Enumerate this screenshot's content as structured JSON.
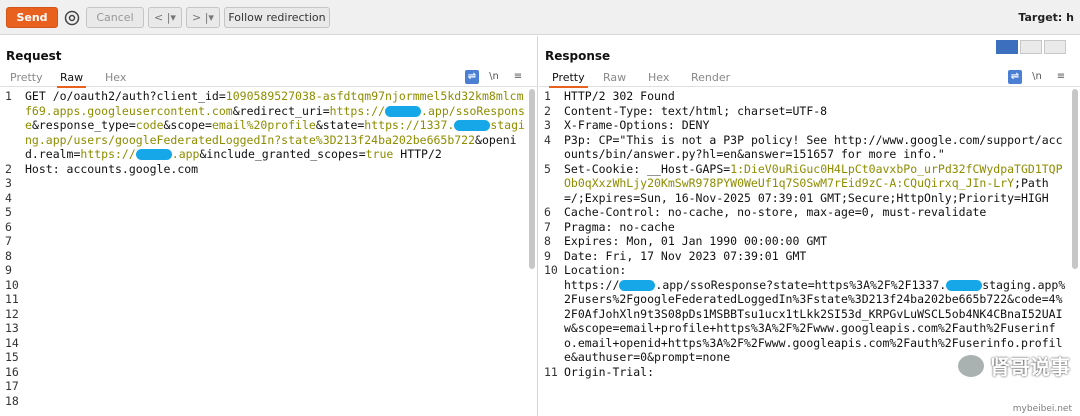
{
  "toolbar": {
    "send_label": "Send",
    "cancel_label": "Cancel",
    "back_label": "< |▾",
    "fwd_label": "> |▾",
    "follow_label": "Follow redirection",
    "target_label": "Target: h"
  },
  "request": {
    "title": "Request",
    "tabs": [
      "Pretty",
      "Raw",
      "Hex"
    ],
    "active_tab": "Raw",
    "wrap_icon": "\\n",
    "menu_icon": "≡",
    "lines": [
      {
        "n": "1",
        "segments": [
          {
            "t": "GET /o/oauth2/auth?client_id=",
            "c": "k"
          },
          {
            "t": "1090589527038-asfdtqm97njormmel5kd32km8mlcmf69.apps.googleusercontent.com",
            "c": "g"
          },
          {
            "t": "&redirect_uri=",
            "c": "k"
          },
          {
            "t": "https://",
            "c": "g"
          },
          {
            "t": "[mask]",
            "c": "mask"
          },
          {
            "t": ".app/ssoResponse",
            "c": "g"
          },
          {
            "t": "&response_type=",
            "c": "k"
          },
          {
            "t": "code",
            "c": "g"
          },
          {
            "t": "&scope=",
            "c": "k"
          },
          {
            "t": "email%20profile",
            "c": "g"
          },
          {
            "t": "&state=",
            "c": "k"
          },
          {
            "t": "https://1337.",
            "c": "g"
          },
          {
            "t": "[mask]",
            "c": "mask"
          },
          {
            "t": "staging.app/users/googleFederatedLoggedIn?state%3D213f24ba202be665b722",
            "c": "g"
          },
          {
            "t": "&openid.realm=",
            "c": "k"
          },
          {
            "t": "https://",
            "c": "g"
          },
          {
            "t": "[mask]",
            "c": "mask"
          },
          {
            "t": ".app",
            "c": "g"
          },
          {
            "t": "&include_granted_scopes=",
            "c": "k"
          },
          {
            "t": "true",
            "c": "g"
          },
          {
            "t": " HTTP/2",
            "c": "k"
          }
        ]
      },
      {
        "n": "2",
        "segments": [
          {
            "t": "Host: accounts.google.com",
            "c": "k"
          }
        ]
      },
      {
        "n": "3",
        "segments": []
      },
      {
        "n": "4",
        "segments": []
      },
      {
        "n": "5",
        "segments": []
      },
      {
        "n": "6",
        "segments": []
      },
      {
        "n": "7",
        "segments": []
      },
      {
        "n": "8",
        "segments": []
      },
      {
        "n": "9",
        "segments": []
      },
      {
        "n": "10",
        "segments": []
      },
      {
        "n": "11",
        "segments": []
      },
      {
        "n": "12",
        "segments": []
      },
      {
        "n": "13",
        "segments": []
      },
      {
        "n": "14",
        "segments": []
      },
      {
        "n": "15",
        "segments": []
      },
      {
        "n": "16",
        "segments": []
      },
      {
        "n": "17",
        "segments": []
      },
      {
        "n": "18",
        "segments": []
      }
    ]
  },
  "response": {
    "title": "Response",
    "tabs": [
      "Pretty",
      "Raw",
      "Hex",
      "Render"
    ],
    "active_tab": "Pretty",
    "wrap_icon": "\\n",
    "menu_icon": "≡",
    "lines": [
      {
        "n": "1",
        "segments": [
          {
            "t": "HTTP/2 302 Found",
            "c": "k"
          }
        ]
      },
      {
        "n": "2",
        "segments": [
          {
            "t": "Content-Type: ",
            "c": "k"
          },
          {
            "t": "text/html; charset=UTF-8",
            "c": "k"
          }
        ]
      },
      {
        "n": "3",
        "segments": [
          {
            "t": "X-Frame-Options: ",
            "c": "k"
          },
          {
            "t": "DENY",
            "c": "k"
          }
        ]
      },
      {
        "n": "4",
        "segments": [
          {
            "t": "P3p: ",
            "c": "k"
          },
          {
            "t": "CP=\"This is not a P3P policy! See http://www.google.com/support/accounts/bin/answer.py?hl=en&answer=151657 for more info.\"",
            "c": "k"
          }
        ]
      },
      {
        "n": "5",
        "segments": [
          {
            "t": "Set-Cookie: ",
            "c": "k"
          },
          {
            "t": "__Host-GAPS=",
            "c": "k"
          },
          {
            "t": "1:DieV0uRiGuc0H4LpCt0avxbPo_urPd32fCWydpaTGD1TQPOb0qXxzWhLjy20KmSwR978PYW0WeUf1q7S0SwM7rEid9zC-A:CQuQirxq_JIn-LrY",
            "c": "g"
          },
          {
            "t": ";Path=/;Expires=Sun, 16-Nov-2025 07:39:01 GMT;Secure;HttpOnly;Priority=HIGH",
            "c": "k"
          }
        ]
      },
      {
        "n": "6",
        "segments": [
          {
            "t": "Cache-Control: ",
            "c": "k"
          },
          {
            "t": "no-cache, no-store, max-age=0, must-revalidate",
            "c": "k"
          }
        ]
      },
      {
        "n": "7",
        "segments": [
          {
            "t": "Pragma: ",
            "c": "k"
          },
          {
            "t": "no-cache",
            "c": "k"
          }
        ]
      },
      {
        "n": "8",
        "segments": [
          {
            "t": "Expires: ",
            "c": "k"
          },
          {
            "t": "Mon, 01 Jan 1990 00:00:00 GMT",
            "c": "k"
          }
        ]
      },
      {
        "n": "9",
        "segments": [
          {
            "t": "Date: ",
            "c": "k"
          },
          {
            "t": "Fri, 17 Nov 2023 07:39:01 GMT",
            "c": "k"
          }
        ]
      },
      {
        "n": "10",
        "segments": [
          {
            "t": "Location: ",
            "c": "k"
          },
          {
            "t": "\nhttps://",
            "c": "k"
          },
          {
            "t": "[mask]",
            "c": "mask"
          },
          {
            "t": ".app/ssoResponse?state=https%3A%2F%2F1337.",
            "c": "k"
          },
          {
            "t": "[mask]",
            "c": "mask"
          },
          {
            "t": "staging.app%2Fusers%2FgoogleFederatedLoggedIn%3Fstate%3D213f24ba202be665b722&code=4%2F0AfJohXln9t3S08pDs1MSBBTsu1ucx1tLkk2SI53d_KRPGvLuWSCL5ob4NK4CBnaI52UAIw&scope=email+profile+https%3A%2F%2Fwww.googleapis.com%2Fauth%2Fuserinfo.email+openid+https%3A%2F%2Fwww.googleapis.com%2Fauth%2Fuserinfo.profile&authuser=0&prompt=none",
            "c": "k"
          }
        ]
      },
      {
        "n": "11",
        "segments": [
          {
            "t": "Origin-Trial: ",
            "c": "k"
          }
        ]
      }
    ]
  },
  "watermark": {
    "text": "肾哥说事",
    "url": "mybeibei.net"
  }
}
